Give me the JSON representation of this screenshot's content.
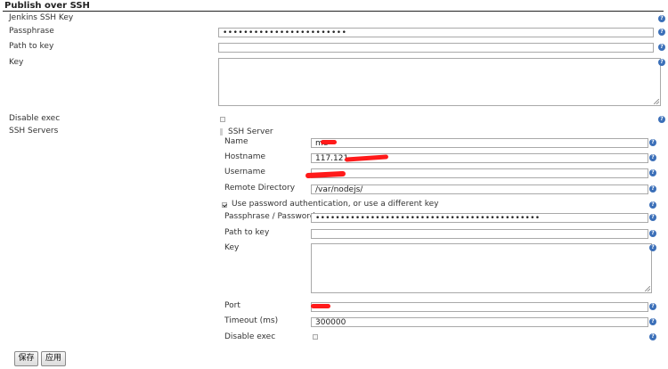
{
  "section": {
    "title": "Publish over SSH"
  },
  "global": {
    "jenkins_ssh_key_label": "Jenkins SSH Key",
    "passphrase_label": "Passphrase",
    "passphrase_value": "••••••••••••••••••••••••",
    "path_to_key_label": "Path to key",
    "path_to_key_value": "",
    "key_label": "Key",
    "disable_exec_label": "Disable exec",
    "disable_exec_checked": false,
    "ssh_servers_label": "SSH Servers"
  },
  "server": {
    "header": "SSH Server",
    "name_label": "Name",
    "name_value": "me",
    "hostname_label": "Hostname",
    "hostname_value": "117.121.",
    "username_label": "Username",
    "username_value": "",
    "remote_dir_label": "Remote Directory",
    "remote_dir_value": "/var/nodejs/",
    "use_password_label": "Use password authentication, or use a different key",
    "use_password_checked": true,
    "pass_label": "Passphrase / Password",
    "pass_value": "•••••••••••••••••••••••••••••••••••••••••••••",
    "path_to_key_label": "Path to key",
    "path_to_key_value": "",
    "key_label": "Key",
    "port_label": "Port",
    "port_value": "",
    "timeout_label": "Timeout (ms)",
    "timeout_value": "300000",
    "disable_exec_label": "Disable exec",
    "disable_exec_checked": false
  },
  "buttons": {
    "save": "保存",
    "apply": "应用"
  },
  "icons": {
    "help": "help-icon",
    "checkbox": "checkbox-icon"
  },
  "colors": {
    "help_icon": "#3b6fb8",
    "redaction": "#ff1a1a"
  }
}
